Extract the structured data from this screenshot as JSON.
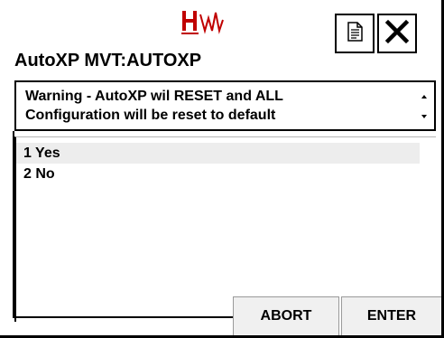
{
  "header": {
    "logo_text": "HW",
    "title": "AutoXP MVT:AUTOXP",
    "doc_icon": "document-icon",
    "close_icon": "close-icon"
  },
  "warning": {
    "line1": "Warning - AutoXP wil RESET and ALL",
    "line2": "Configuration will be reset to default"
  },
  "options": [
    {
      "label": "1 Yes",
      "selected": true
    },
    {
      "label": "2 No",
      "selected": false
    }
  ],
  "buttons": {
    "abort": "ABORT",
    "enter": "ENTER"
  },
  "colors": {
    "logo_red": "#c00000",
    "selected_row": "#ededed",
    "button_bg": "#f0f0f0"
  }
}
